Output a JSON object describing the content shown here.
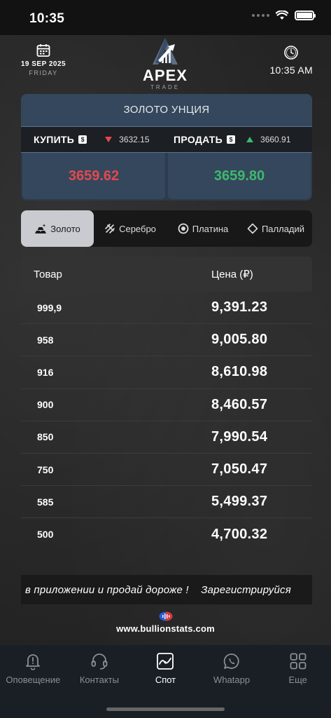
{
  "status_bar": {
    "time": "10:35"
  },
  "header": {
    "date": "19 SEP 2025",
    "day": "FRIDAY",
    "logo_name": "APEX",
    "logo_sub": "TRADE",
    "time": "10:35 AM"
  },
  "price_card": {
    "title": "ЗОЛОТО УНЦИЯ",
    "buy_label": "КУПИТЬ",
    "sell_label": "ПРОДАТЬ",
    "currency_symbol": "$",
    "buy_small": "3632.15",
    "sell_small": "3660.91",
    "buy_price": "3659.62",
    "sell_price": "3659.80",
    "buy_color": "#e5484d",
    "sell_color": "#3fb86b"
  },
  "metal_tabs": [
    {
      "label": "Золото",
      "icon": "gold-bars-icon",
      "active": true
    },
    {
      "label": "Серебро",
      "icon": "silver-icon",
      "active": false
    },
    {
      "label": "Платина",
      "icon": "platinum-icon",
      "active": false
    },
    {
      "label": "Палладий",
      "icon": "palladium-icon",
      "active": false
    }
  ],
  "table": {
    "col_product": "Товар",
    "col_price": "Цена (₽)",
    "rows": [
      {
        "product": "999,9",
        "price": "9,391.23"
      },
      {
        "product": "958",
        "price": "9,005.80"
      },
      {
        "product": "916",
        "price": "8,610.98"
      },
      {
        "product": "900",
        "price": "8,460.57"
      },
      {
        "product": "850",
        "price": "7,990.54"
      },
      {
        "product": "750",
        "price": "7,050.47"
      },
      {
        "product": "585",
        "price": "5,499.37"
      },
      {
        "product": "500",
        "price": "4,700.32"
      }
    ]
  },
  "ticker": {
    "text": "в приложении и продай дороже !    Зарегистрируйся"
  },
  "source": {
    "text": "www.bullionstats.com"
  },
  "bottom_nav": [
    {
      "label": "Оповещение",
      "icon": "bell-alert-icon",
      "active": false
    },
    {
      "label": "Контакты",
      "icon": "headset-icon",
      "active": false
    },
    {
      "label": "Спот",
      "icon": "spot-chart-icon",
      "active": true
    },
    {
      "label": "Whatapp",
      "icon": "whatsapp-icon",
      "active": false
    },
    {
      "label": "Еще",
      "icon": "grid-more-icon",
      "active": false
    }
  ]
}
